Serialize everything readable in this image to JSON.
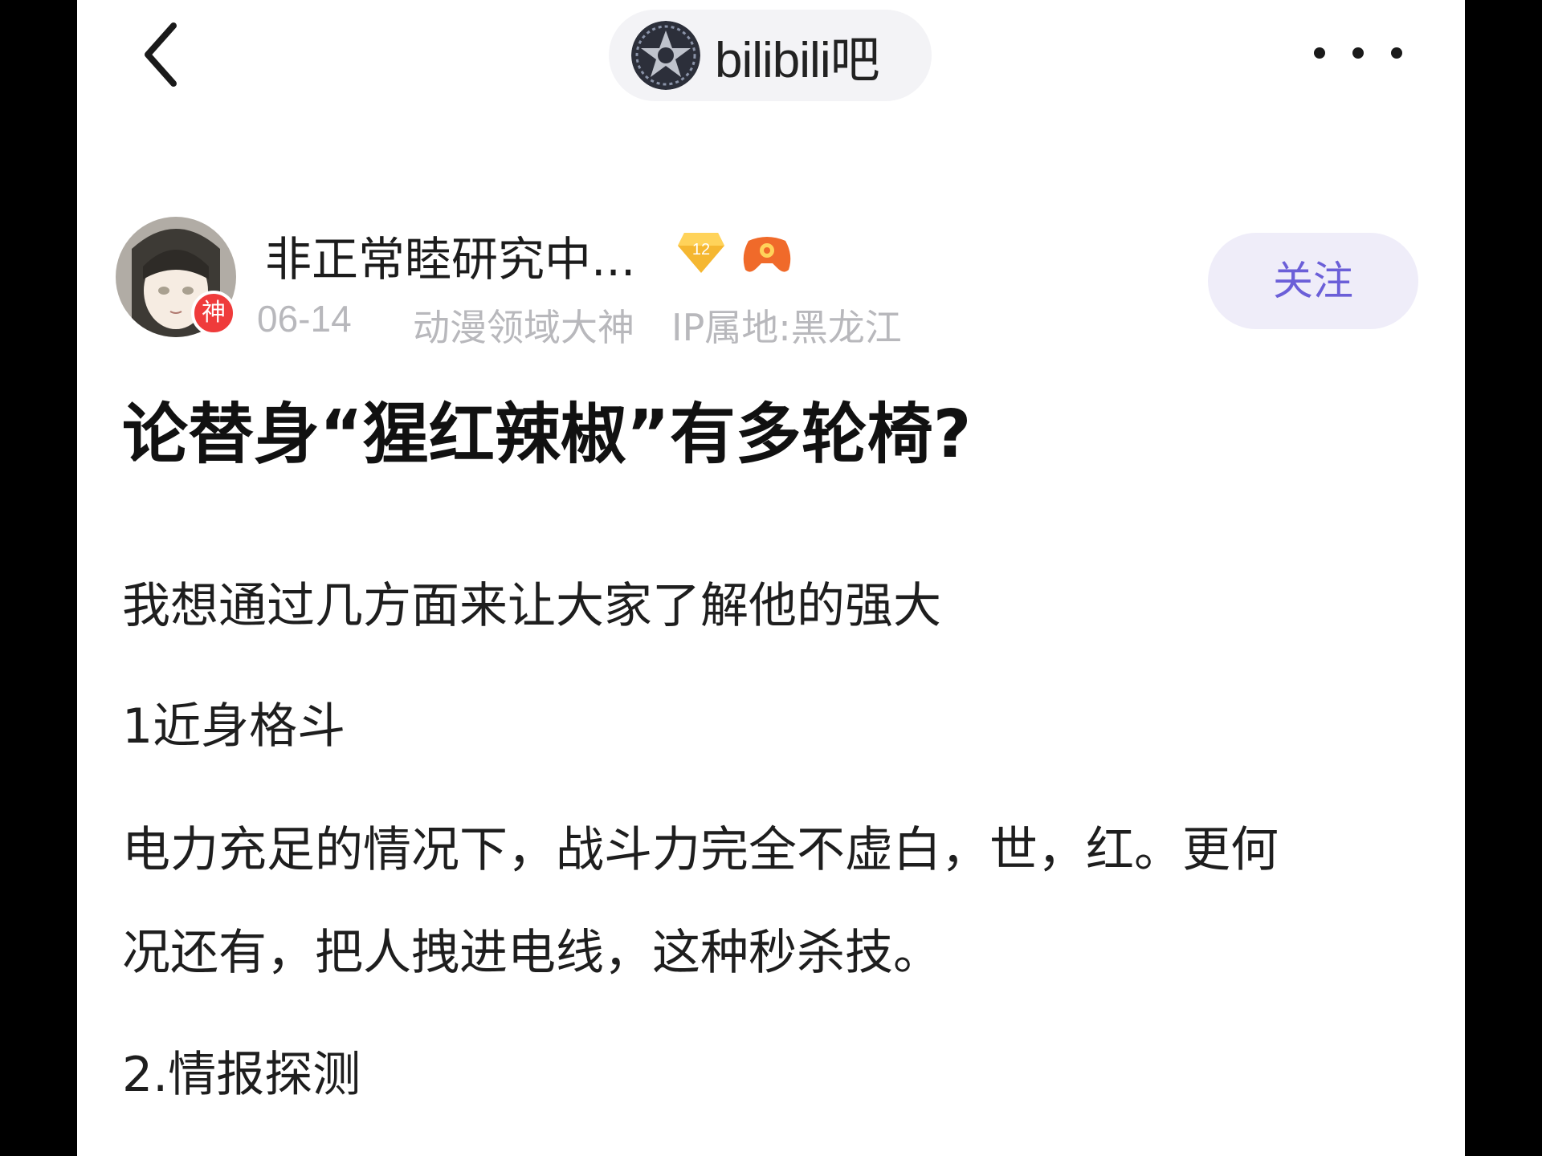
{
  "header": {
    "forum_name": "bilibili吧",
    "back_icon": "chevron-left-icon",
    "more_icon": "more-horizontal-icon"
  },
  "author": {
    "name": "非正常睦研究中...",
    "level": "12",
    "badge": "神",
    "date": "06-14",
    "title": "动漫领域大神",
    "ip": "IP属地:黑龙江",
    "follow_label": "关注"
  },
  "post": {
    "title": "论替身“猩红辣椒”有多轮椅?",
    "paragraphs": [
      "我想通过几方面来让大家了解他的强大",
      "1近身格斗",
      "电力充足的情况下，战斗力完全不虚白，世，红。更何",
      "况还有，把人拽进电线，这种秒杀技。",
      "2.情报探测"
    ]
  },
  "colors": {
    "accent": "#6b5fd8",
    "follow_bg": "#efedf9",
    "meta_text": "#b8b8bc",
    "badge_red": "#ef3b3b"
  }
}
